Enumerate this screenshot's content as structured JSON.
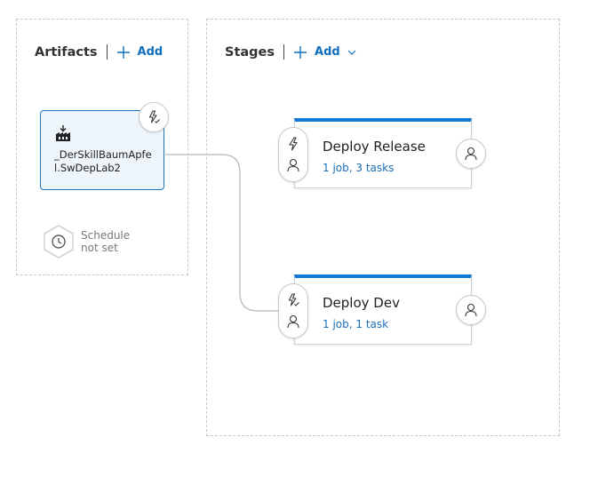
{
  "artifacts": {
    "title": "Artifacts",
    "add_label": "Add",
    "items": [
      {
        "name": "_DerSkillBaumApfel.SwDepLab2",
        "icon": "build-icon",
        "trigger_icon": "continuous-deployment-trigger-icon"
      }
    ],
    "schedule": {
      "line1": "Schedule",
      "line2": "not set",
      "icon": "clock-icon"
    }
  },
  "stages": {
    "title": "Stages",
    "add_label": "Add",
    "items": [
      {
        "name": "Deploy Release",
        "summary": "1 job, 3 tasks"
      },
      {
        "name": "Deploy Dev",
        "summary": "1 job, 1 task"
      }
    ]
  },
  "colors": {
    "accent": "#0f78d4",
    "link": "#106ebe",
    "artifact_bg": "#eef6fc"
  }
}
